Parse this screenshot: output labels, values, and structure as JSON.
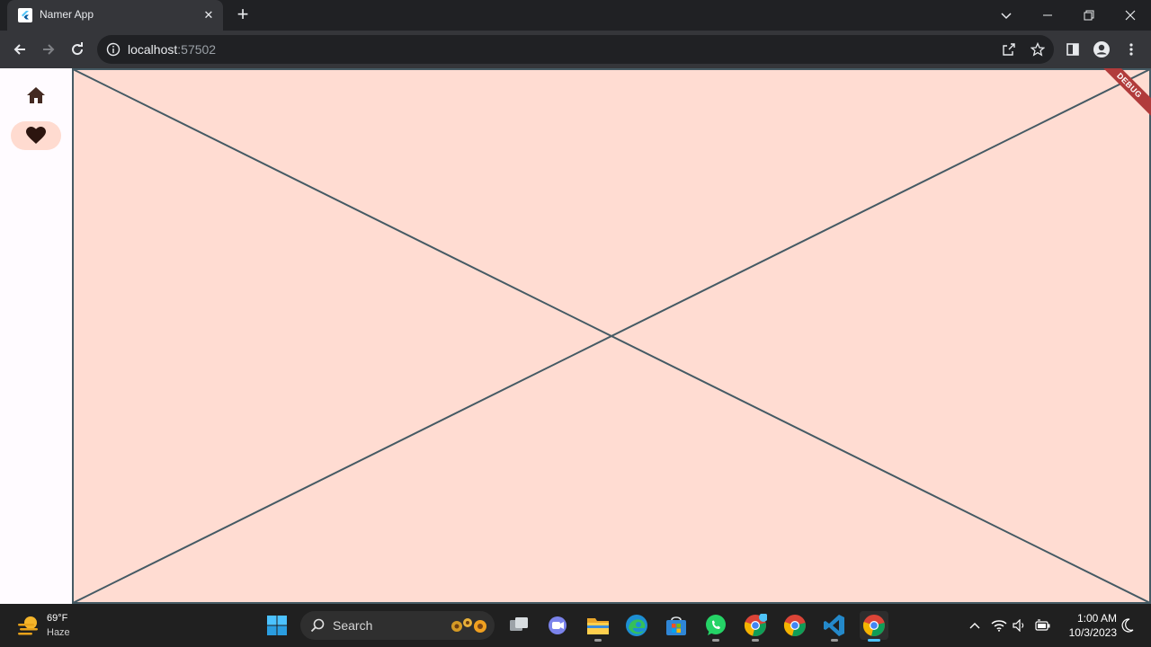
{
  "browser": {
    "tab": {
      "title": "Namer App",
      "favicon": "flutter-logo-icon",
      "close_icon": "close-icon"
    },
    "new_tab_icon": "plus-icon",
    "window_controls": [
      "chevron-down-icon",
      "minimize-icon",
      "restore-icon",
      "close-icon"
    ],
    "url": {
      "host": "localhost",
      "port": ":57502"
    },
    "toolbar_icons": [
      "back-icon",
      "forward-icon",
      "reload-icon",
      "info-icon",
      "share-icon",
      "star-icon",
      "side-panel-icon",
      "profile-icon",
      "kebab-menu-icon"
    ]
  },
  "app": {
    "nav_rail": [
      {
        "icon": "home-icon",
        "selected": false
      },
      {
        "icon": "heart-icon",
        "selected": true
      }
    ],
    "debug_banner": "DEBUG",
    "colors": {
      "content_bg": "#ffdcd2",
      "rail_bg": "#fffbff",
      "rail_selected": "#ffdbd0",
      "placeholder_line": "#455a64",
      "icon": "#442a22"
    }
  },
  "taskbar": {
    "weather": {
      "temp": "69°F",
      "desc": "Haze"
    },
    "search_label": "Search",
    "apps": [
      "windows-start-icon",
      "search-icon",
      "task-view-icon",
      "teams-chat-icon",
      "file-explorer-icon",
      "edge-icon",
      "store-icon",
      "whatsapp-icon",
      "chrome-profile-icon",
      "chrome-icon",
      "vscode-icon",
      "chrome-active-icon"
    ],
    "tray_icons": [
      "chevron-up-icon",
      "wifi-icon",
      "volume-icon",
      "battery-icon",
      "night-mode-icon"
    ],
    "clock": {
      "time": "1:00 AM",
      "date": "10/3/2023"
    }
  }
}
